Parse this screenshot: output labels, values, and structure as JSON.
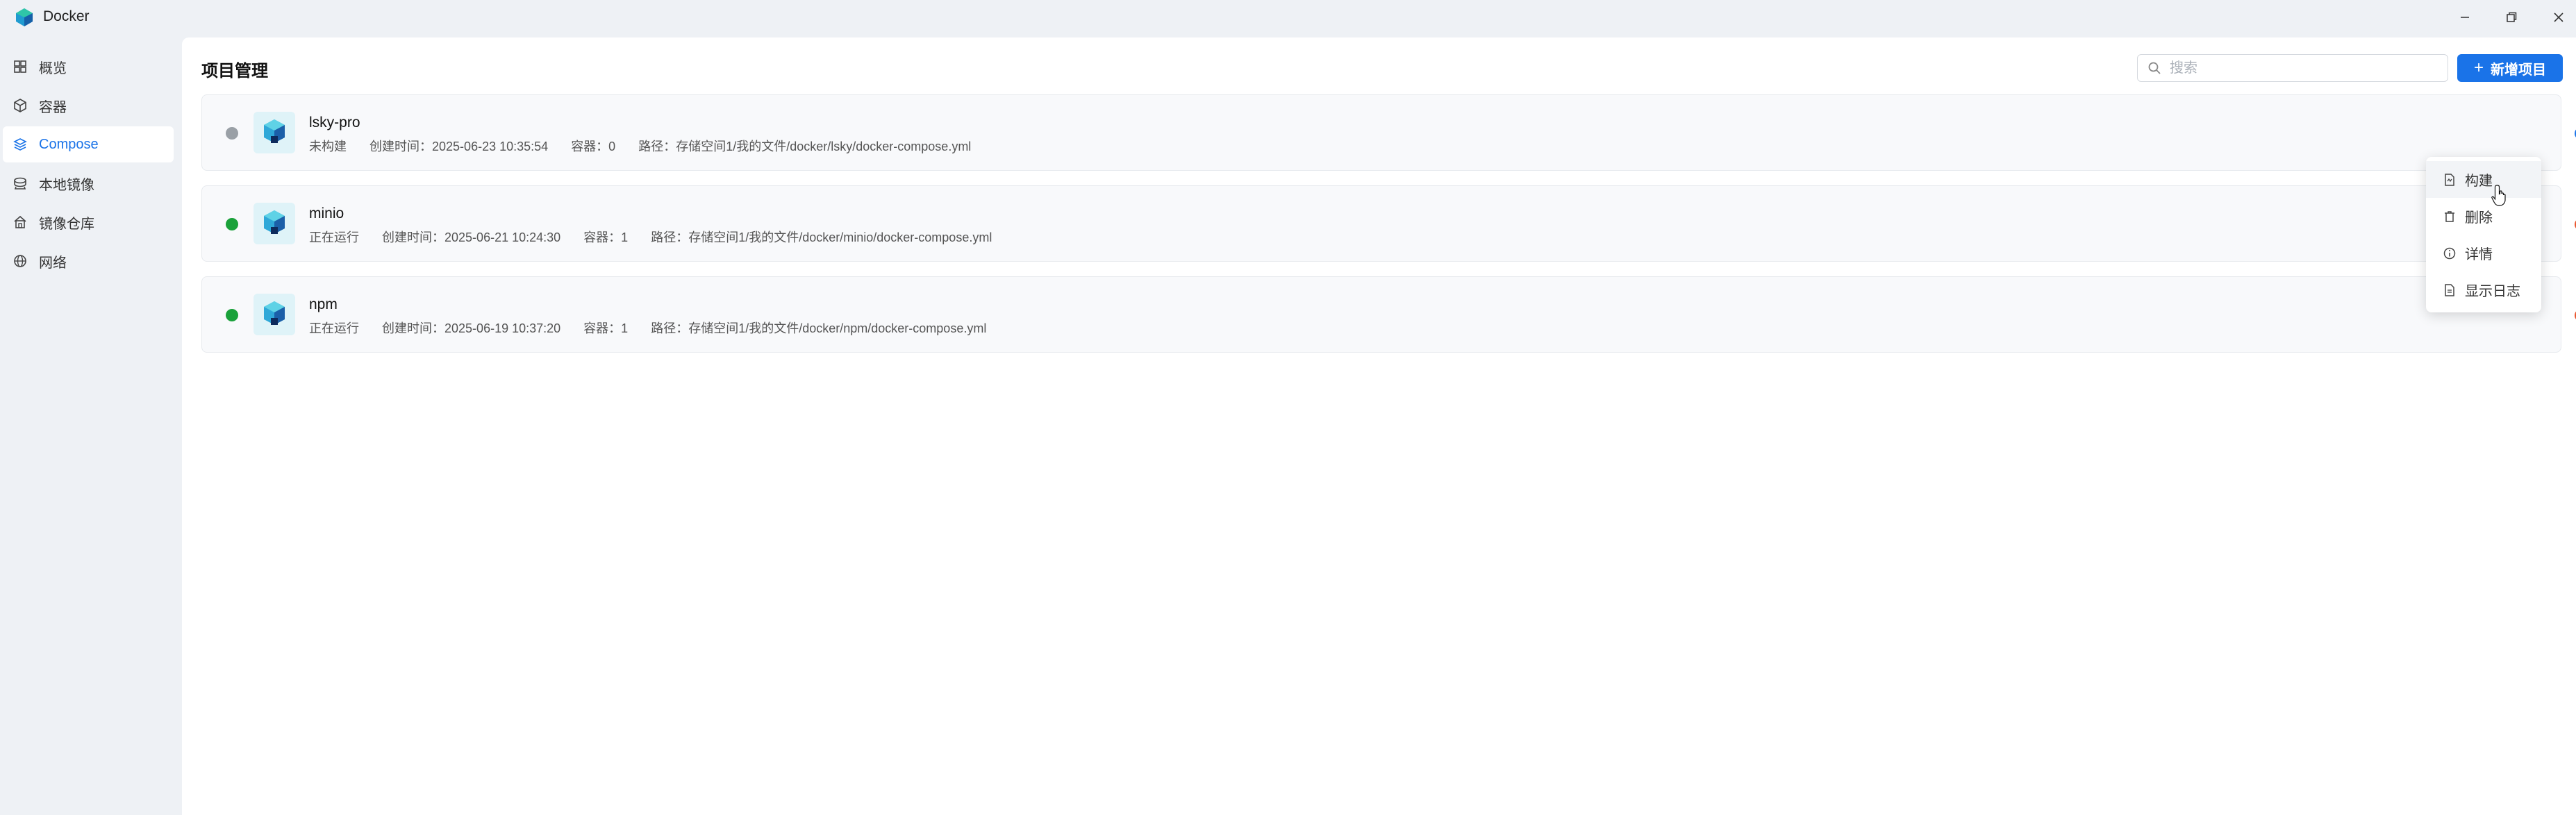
{
  "app": {
    "title": "Docker"
  },
  "sidebar": {
    "items": [
      {
        "label": "概览",
        "icon": "grid-icon"
      },
      {
        "label": "容器",
        "icon": "box-icon"
      },
      {
        "label": "Compose",
        "icon": "layers-icon",
        "active": true
      },
      {
        "label": "本地镜像",
        "icon": "disk-icon"
      },
      {
        "label": "镜像仓库",
        "icon": "home-icon"
      },
      {
        "label": "网络",
        "icon": "globe-icon"
      }
    ]
  },
  "main": {
    "title": "项目管理",
    "search": {
      "placeholder": "搜索",
      "value": ""
    },
    "add_button": "新增项目"
  },
  "projects": [
    {
      "name": "lsky-pro",
      "status": "未构建",
      "status_color": "#9aa0a6",
      "created": "创建时间：2025-06-23 10:35:54",
      "containers": "容器：0",
      "path": "路径：存储空间1/我的文件/docker/lsky/docker-compose.yml",
      "power_color": "#1a73e8"
    },
    {
      "name": "minio",
      "status": "正在运行",
      "status_color": "#1aa13a",
      "created": "创建时间：2025-06-21 10:24:30",
      "containers": "容器：1",
      "path": "路径：存储空间1/我的文件/docker/minio/docker-compose.yml",
      "power_color": "#e8552d"
    },
    {
      "name": "npm",
      "status": "正在运行",
      "status_color": "#1aa13a",
      "created": "创建时间：2025-06-19 10:37:20",
      "containers": "容器：1",
      "path": "路径：存储空间1/我的文件/docker/npm/docker-compose.yml",
      "power_color": "#e8552d"
    }
  ],
  "context_menu": {
    "items": [
      {
        "label": "构建",
        "icon": "build-file-icon"
      },
      {
        "label": "删除",
        "icon": "trash-icon"
      },
      {
        "label": "详情",
        "icon": "info-icon"
      },
      {
        "label": "显示日志",
        "icon": "log-file-icon"
      }
    ]
  }
}
